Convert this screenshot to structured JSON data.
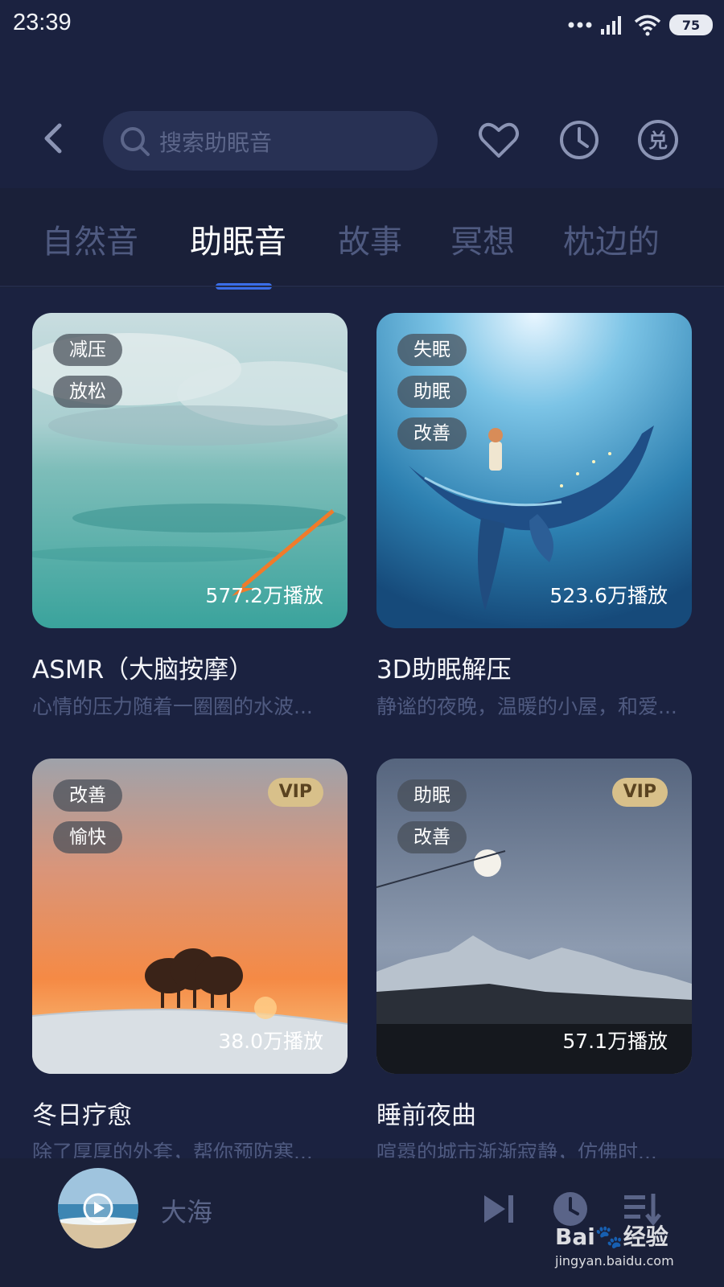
{
  "status_bar": {
    "time": "23:39",
    "battery": "75"
  },
  "header": {
    "search_placeholder": "搜索助眠音"
  },
  "tabs": [
    {
      "label": "自然音",
      "active": false
    },
    {
      "label": "助眠音",
      "active": true
    },
    {
      "label": "故事",
      "active": false
    },
    {
      "label": "冥想",
      "active": false
    },
    {
      "label": "枕边的",
      "active": false
    }
  ],
  "cards": [
    {
      "tags": [
        "减压",
        "放松"
      ],
      "vip": "",
      "plays": "577.2万播放",
      "title": "ASMR（大脑按摩）",
      "desc": "心情的压力随着一圈圈的水波..."
    },
    {
      "tags": [
        "失眠",
        "助眠",
        "改善"
      ],
      "vip": "",
      "plays": "523.6万播放",
      "title": "3D助眠解压",
      "desc": "静谧的夜晚，温暖的小屋，和爱..."
    },
    {
      "tags": [
        "改善",
        "愉快"
      ],
      "vip": "VIP",
      "plays": "38.0万播放",
      "title": "冬日疗愈",
      "desc": "除了厚厚的外套，帮你预防寒..."
    },
    {
      "tags": [
        "助眠",
        "改善"
      ],
      "vip": "VIP",
      "plays": "57.1万播放",
      "title": "睡前夜曲",
      "desc": "喧嚣的城市渐渐寂静，仿佛时..."
    }
  ],
  "player": {
    "title": "大海"
  },
  "watermark": {
    "brand": "Bai",
    "brand2": "经验",
    "url": "jingyan.baidu.com"
  },
  "colors": {
    "background": "#1b2240",
    "accent": "#3a6de6",
    "vip": "#d8c08a"
  }
}
